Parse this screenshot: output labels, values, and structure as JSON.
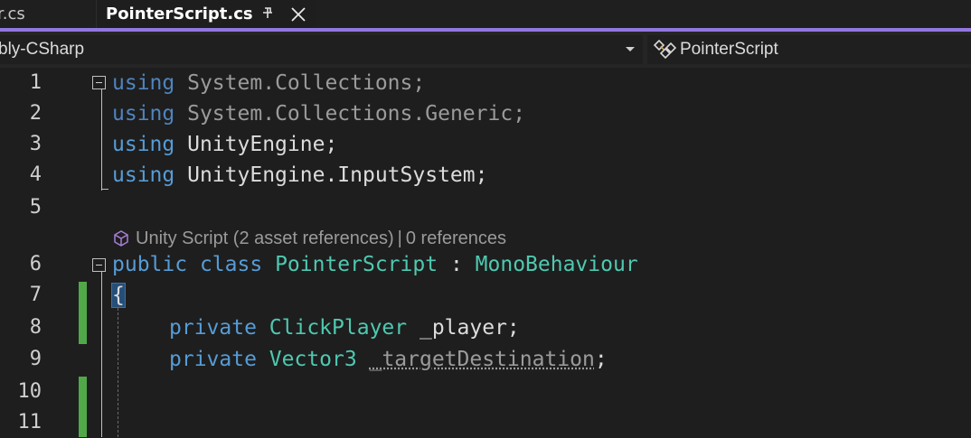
{
  "tabs": {
    "inactive_label": "r.cs",
    "active_label": "PointerScript.cs"
  },
  "navbar": {
    "project": "bly-CSharp",
    "class_name": "PointerScript"
  },
  "codelens": {
    "unity": "Unity Script (2 asset references)",
    "separator": "|",
    "refs": "0 references"
  },
  "lines": [
    {
      "num": "1"
    },
    {
      "num": "2"
    },
    {
      "num": "3"
    },
    {
      "num": "4"
    },
    {
      "num": "5"
    },
    {
      "num": "6"
    },
    {
      "num": "7"
    },
    {
      "num": "8"
    },
    {
      "num": "9"
    },
    {
      "num": "10"
    },
    {
      "num": "11"
    }
  ],
  "code": {
    "l1": {
      "kw": "using",
      "a": "System",
      "dot": ".",
      "b": "Collections",
      "semi": ";"
    },
    "l2": {
      "kw": "using",
      "a": "System",
      "dot1": ".",
      "b": "Collections",
      "dot2": ".",
      "c": "Generic",
      "semi": ";"
    },
    "l3": {
      "kw": "using",
      "a": "UnityEngine",
      "semi": ";"
    },
    "l4": {
      "kw": "using",
      "a": "UnityEngine",
      "dot": ".",
      "b": "InputSystem",
      "semi": ";"
    },
    "l6": {
      "kw1": "public",
      "kw2": "class",
      "name": "PointerScript",
      "colon": ":",
      "base": "MonoBehaviour"
    },
    "l7": {
      "brace": "{"
    },
    "l8": {
      "kw": "private",
      "type": "ClickPlayer",
      "field": "_player",
      "semi": ";"
    },
    "l9": {
      "kw": "private",
      "type": "Vector3",
      "field": "_targetDestination",
      "semi": ";"
    }
  },
  "colors": {
    "accent": "#9177e0",
    "keyword": "#569cd6",
    "type": "#4ec9b0",
    "change_bar": "#51a849"
  },
  "icons": {
    "pin": "pin-icon",
    "close": "close-icon",
    "class": "class-icon",
    "unity": "unity-cube-icon"
  }
}
